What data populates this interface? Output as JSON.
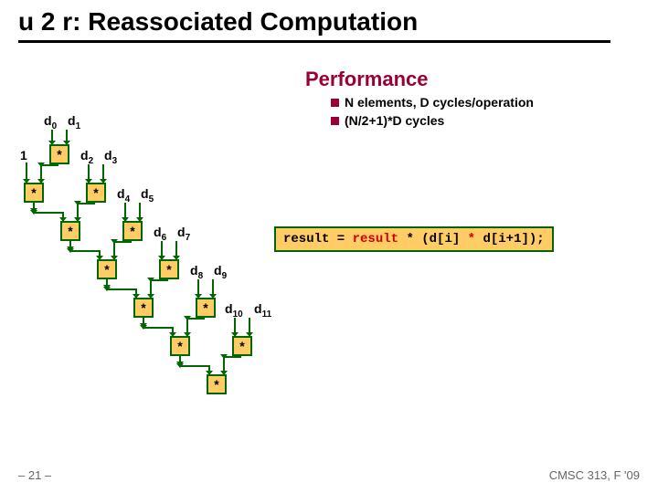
{
  "title": "u 2 r: Reassociated Computation",
  "perf_heading": "Performance",
  "bullets": [
    "N elements, D cycles/operation",
    "(N/2+1)*D cycles"
  ],
  "labels": {
    "one": "1",
    "d0": "d",
    "d0s": "0",
    "d1": "d",
    "d1s": "1",
    "d2": "d",
    "d2s": "2",
    "d3": "d",
    "d3s": "3",
    "d4": "d",
    "d4s": "4",
    "d5": "d",
    "d5s": "5",
    "d6": "d",
    "d6s": "6",
    "d7": "d",
    "d7s": "7",
    "d8": "d",
    "d8s": "8",
    "d9": "d",
    "d9s": "9",
    "d10": "d",
    "d10s": "10",
    "d11": "d",
    "d11s": "11"
  },
  "mul": "*",
  "code": {
    "pre": "result = ",
    "kw": "result",
    "mid": " * (d[i] ",
    "kw2": "*",
    "post": " d[i+1]);"
  },
  "footer": {
    "left": "– 21 –",
    "right": "CMSC 313, F '09"
  }
}
